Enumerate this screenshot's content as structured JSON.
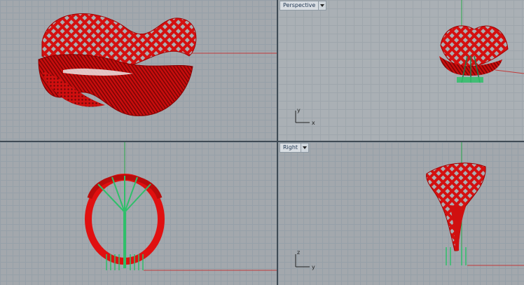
{
  "viewports": {
    "top_left": {
      "label": ""
    },
    "top_right": {
      "label": "Perspective",
      "axes": {
        "v": "y",
        "h": "x"
      }
    },
    "bottom_left": {
      "label": ""
    },
    "bottom_right": {
      "label": "Right",
      "axes": {
        "v": "z",
        "h": "y"
      }
    }
  },
  "colors": {
    "model": "#e01010",
    "supports": "#2fbf6a",
    "axis_x": "#c23a3a",
    "axis_y": "#2aa94a"
  }
}
